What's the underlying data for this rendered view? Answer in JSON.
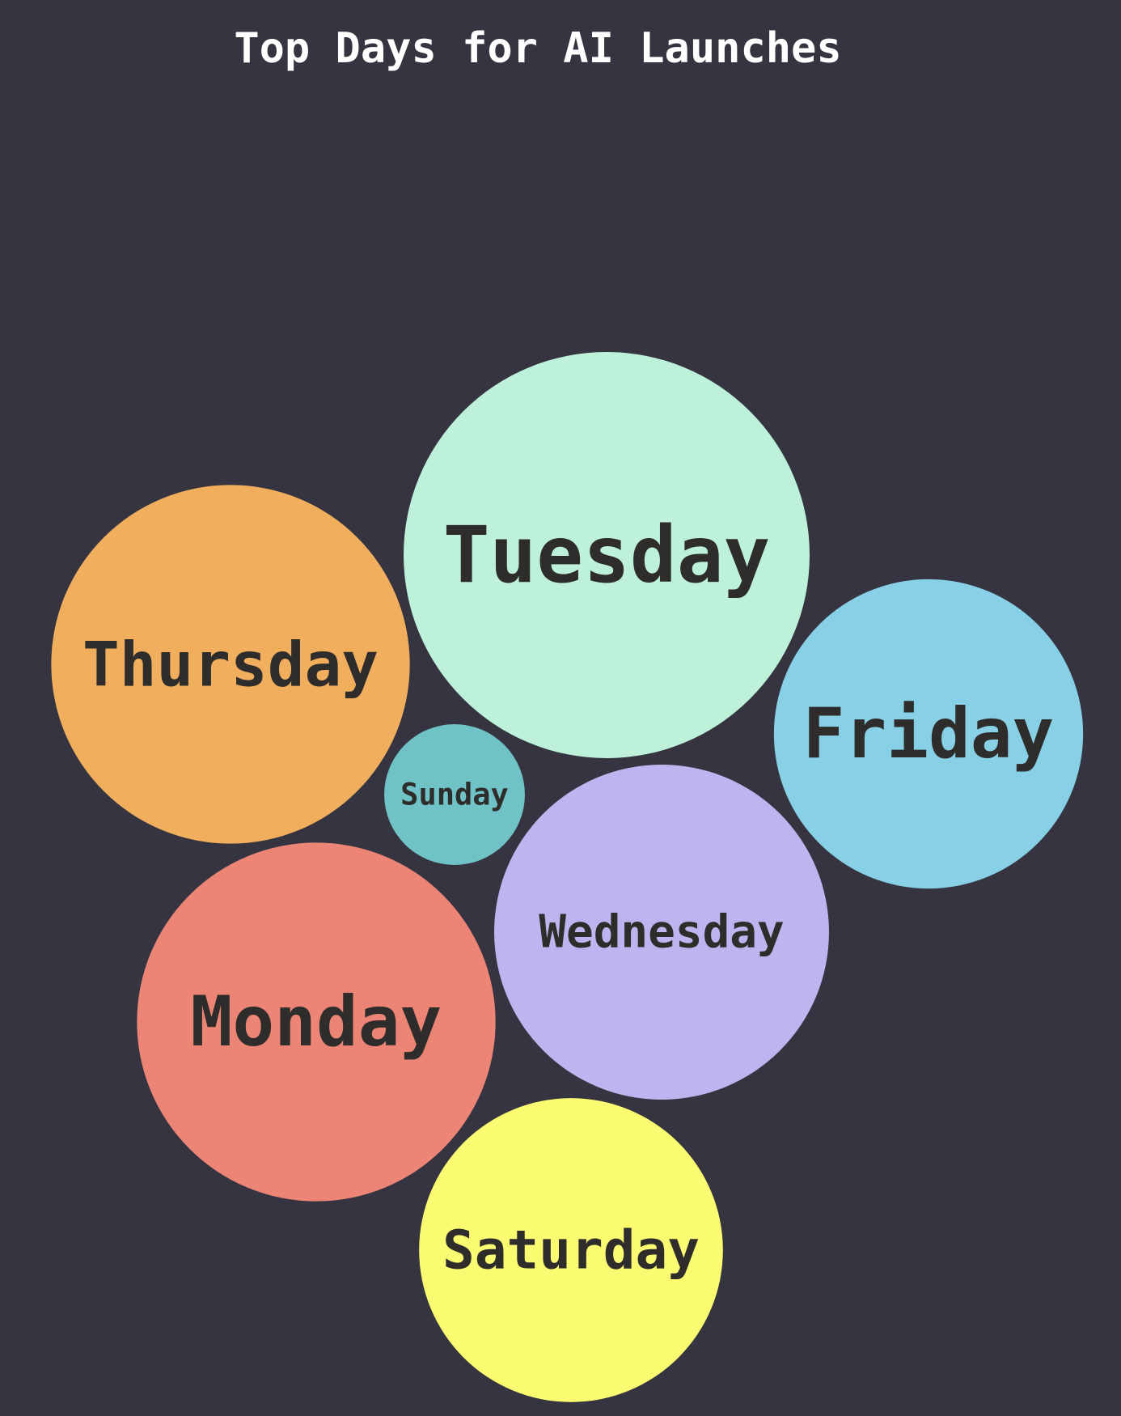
{
  "chart_data": {
    "type": "bubble",
    "title": "Top Days for AI Launches",
    "colors": {
      "background": "#353440",
      "title": "#ffffff",
      "label": "#2e2d2b"
    },
    "bubbles": [
      {
        "label": "Tuesday",
        "value": 100,
        "color": "#bef1da"
      },
      {
        "label": "Thursday",
        "value": 78,
        "color": "#f1af5e"
      },
      {
        "label": "Monday",
        "value": 78,
        "color": "#ec8576"
      },
      {
        "label": "Wednesday",
        "value": 68,
        "color": "#c0b4f0"
      },
      {
        "label": "Friday",
        "value": 58,
        "color": "#87d0e5"
      },
      {
        "label": "Saturday",
        "value": 56,
        "color": "#fbfb72"
      },
      {
        "label": "Sunday",
        "value": 12,
        "color": "#6fc3c6"
      }
    ]
  }
}
